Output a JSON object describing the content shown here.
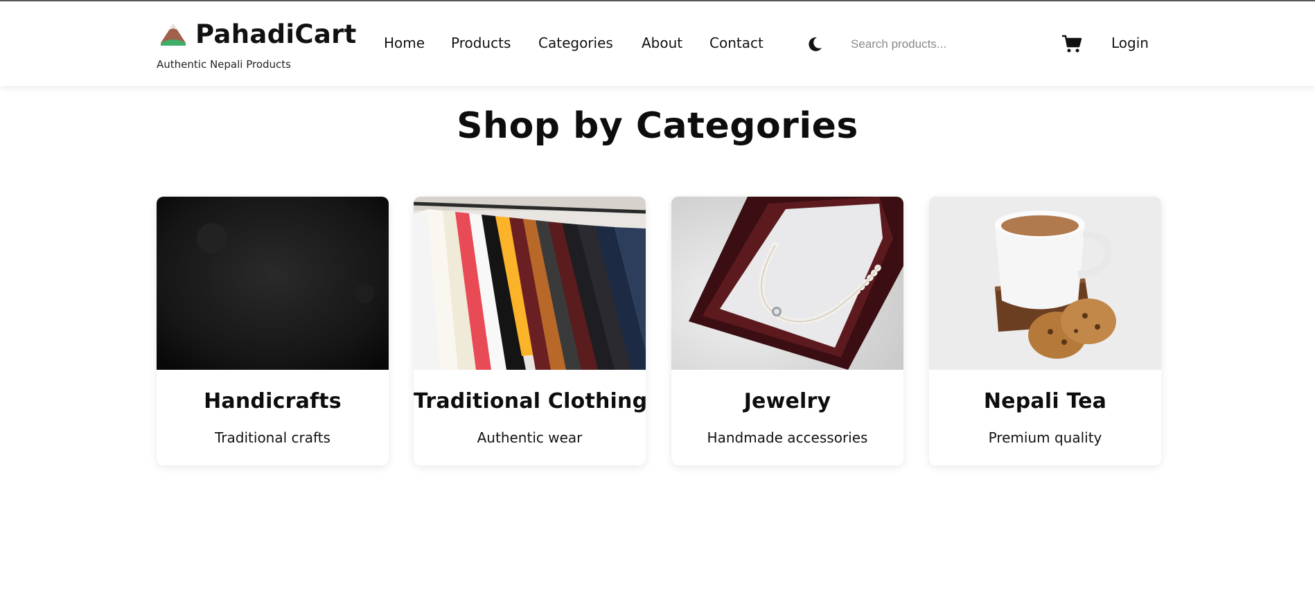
{
  "brand": {
    "name": "PahadiCart",
    "tagline": "Authentic Nepali Products",
    "logo_icon": "mountain-icon"
  },
  "nav": {
    "items": [
      {
        "label": "Home"
      },
      {
        "label": "Products"
      },
      {
        "label": "Categories"
      },
      {
        "label": "About"
      },
      {
        "label": "Contact"
      }
    ]
  },
  "header": {
    "theme_icon": "moon-icon",
    "search_placeholder": "Search products...",
    "cart_icon": "cart-icon",
    "login_label": "Login"
  },
  "section": {
    "title": "Shop by Categories"
  },
  "categories": [
    {
      "title": "Handicrafts",
      "description": "Traditional crafts",
      "image": "dark-texture-image"
    },
    {
      "title": "Traditional Clothing",
      "description": "Authentic wear",
      "image": "clothing-rack-image"
    },
    {
      "title": "Jewelry",
      "description": "Handmade accessories",
      "image": "pearl-necklace-image"
    },
    {
      "title": "Nepali Tea",
      "description": "Premium quality",
      "image": "tea-cup-image"
    }
  ],
  "colors": {
    "text": "#111111",
    "background": "#ffffff",
    "logo_mountain": "#a0604a",
    "logo_grass": "#3fae6a"
  }
}
